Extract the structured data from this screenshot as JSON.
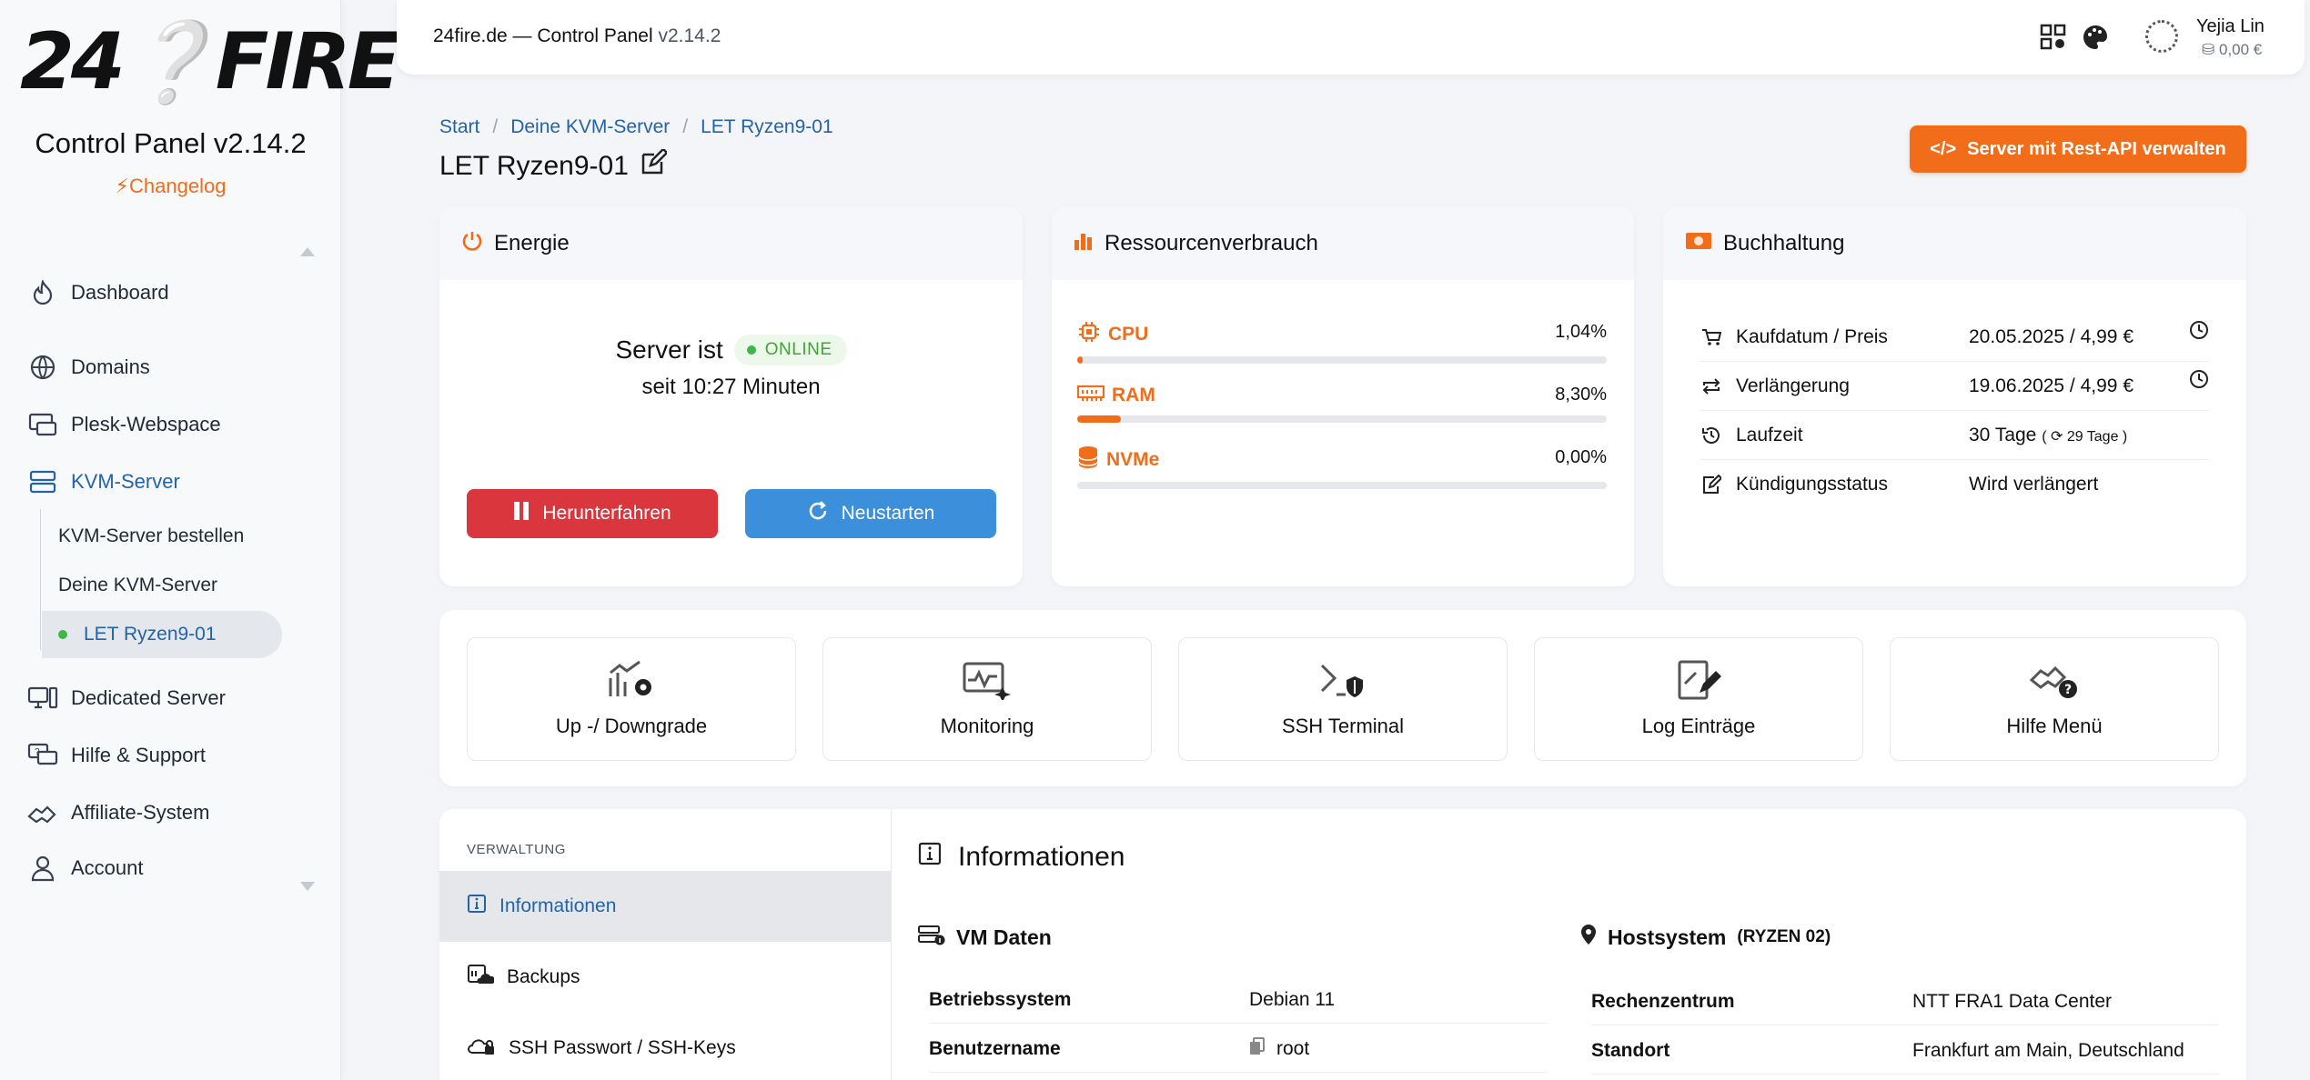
{
  "sidebar": {
    "logo_text_a": "24",
    "logo_text_b": "FIRE",
    "cp_title": "Control Panel v2.14.2",
    "changelog": "Changelog",
    "nav": {
      "dashboard": "Dashboard",
      "domains": "Domains",
      "plesk": "Plesk-Webspace",
      "kvm": "KVM-Server",
      "dedicated": "Dedicated Server",
      "hilfe": "Hilfe & Support",
      "affiliate": "Affiliate-System",
      "account": "Account"
    },
    "kvm_sub": {
      "bestellen": "KVM-Server bestellen",
      "deine": "Deine KVM-Server",
      "current": "LET Ryzen9-01"
    }
  },
  "topbar": {
    "title": "24fire.de — Control Panel",
    "version": "v2.14.2",
    "user_name": "Yejia Lin",
    "balance": "0,00 €"
  },
  "breadcrumb": [
    "Start",
    "Deine KVM-Server",
    "LET Ryzen9-01"
  ],
  "page_title": "LET Ryzen9-01",
  "api_button": "Server mit Rest-API verwalten",
  "energy": {
    "title": "Energie",
    "status_prefix": "Server ist",
    "status": "ONLINE",
    "uptime": "seit 10:27 Minuten",
    "shutdown": "Herunterfahren",
    "restart": "Neustarten"
  },
  "resources": {
    "title": "Ressourcenverbrauch",
    "cpu": {
      "label": "CPU",
      "value": "1,04%",
      "pct": 1.04
    },
    "ram": {
      "label": "RAM",
      "value": "8,30%",
      "pct": 8.3
    },
    "nvme": {
      "label": "NVMe",
      "value": "0,00%",
      "pct": 0
    }
  },
  "billing": {
    "title": "Buchhaltung",
    "rows": [
      {
        "label": "Kaufdatum / Preis",
        "value": "20.05.2025 / 4,99 €"
      },
      {
        "label": "Verlängerung",
        "value": "19.06.2025 / 4,99 €"
      },
      {
        "label": "Laufzeit",
        "value": "30 Tage",
        "extra": "( ⟳ 29 Tage )"
      },
      {
        "label": "Kündigungsstatus",
        "value": "Wird verlängert"
      }
    ]
  },
  "actions": [
    "Up -/ Downgrade",
    "Monitoring",
    "SSH Terminal",
    "Log Einträge",
    "Hilfe Menü"
  ],
  "management": {
    "header": "VERWALTUNG",
    "items": [
      "Informationen",
      "Backups",
      "SSH Passwort / SSH-Keys"
    ]
  },
  "info": {
    "title": "Informationen",
    "vm": {
      "title": "VM Daten",
      "rows": [
        {
          "k": "Betriebssystem",
          "v": "Debian 11"
        },
        {
          "k": "Benutzername",
          "v": "root"
        }
      ]
    },
    "host": {
      "title": "Hostsystem",
      "sub": "(RYZEN 02)",
      "rows": [
        {
          "k": "Rechenzentrum",
          "v": "NTT FRA1 Data Center"
        },
        {
          "k": "Standort",
          "v": "Frankfurt am Main, Deutschland"
        }
      ]
    }
  },
  "colors": {
    "accent": "#f26d1a",
    "link": "#2563a8",
    "danger": "#d9363e",
    "primary": "#3b8fdb",
    "online": "#3fb54a"
  }
}
